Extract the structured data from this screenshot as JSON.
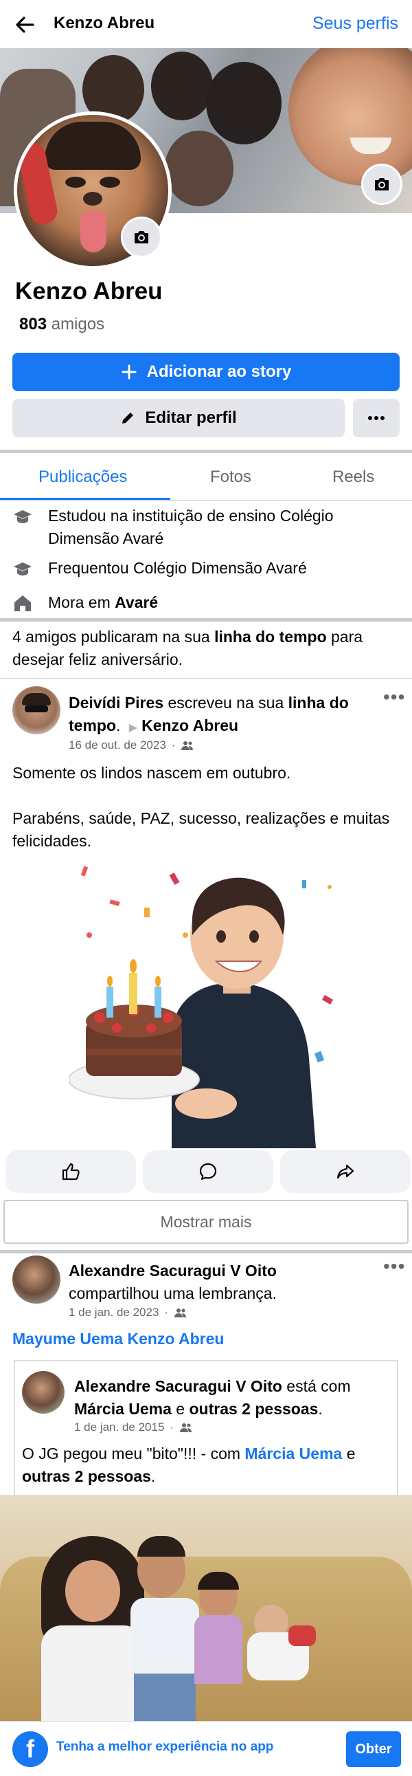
{
  "header": {
    "title": "Kenzo Abreu",
    "link": "Seus perfis"
  },
  "profile": {
    "name": "Kenzo Abreu",
    "friends_count": "803",
    "friends_label": "amigos"
  },
  "buttons": {
    "add_story": "Adicionar ao story",
    "edit_profile": "Editar perfil"
  },
  "tabs": [
    {
      "label": "Publicações",
      "active": true
    },
    {
      "label": "Fotos",
      "active": false
    },
    {
      "label": "Reels",
      "active": false
    }
  ],
  "info": [
    {
      "icon": "graduation-cap-icon",
      "text": "Estudou na instituição de ensino Colégio Dimensão Avaré"
    },
    {
      "icon": "graduation-cap-icon",
      "text": "Frequentou Colégio Dimensão Avaré"
    },
    {
      "icon": "home-icon",
      "prefix": "Mora em ",
      "bold": "Avaré"
    }
  ],
  "birthday_note": {
    "prefix": "4 amigos publicaram na sua ",
    "bold": "linha do tempo",
    "suffix": " para desejar feliz aniversário."
  },
  "post1": {
    "author": "Deivídi Pires",
    "action": " escreveu na sua ",
    "target": "linha do tempo",
    "period": ".",
    "recipient": "Kenzo Abreu",
    "date": "16 de out. de 2023",
    "text_line1": "Somente os lindos nascem em outubro.",
    "text_line2": "Parabéns, saúde, PAZ, sucesso, realizações e muitas felicidades."
  },
  "show_more": "Mostrar mais",
  "post2": {
    "author": "Alexandre Sacuragui V Oito",
    "action": "compartilhou uma lembrança.",
    "date": "1 de jan. de 2023",
    "tagline": "Mayume Uema Kenzo Abreu",
    "shared": {
      "author": "Alexandre Sacuragui V Oito",
      "with": " está com ",
      "tag1": "Márcia Uema",
      "and": " e ",
      "tag2": "outras 2 pessoas",
      "period": ".",
      "date": "1 de jan. de 2015",
      "text_prefix": "O JG pegou meu \"bito\"!!! - com ",
      "text_tag1": "Márcia Uema",
      "text_and": " e ",
      "text_tag2": "outras 2 pessoas",
      "text_period": "."
    }
  },
  "bottom_bar": {
    "text": "Tenha a melhor experiência no app",
    "button": "Obter"
  },
  "colors": {
    "accent": "#1877f2",
    "secondary_text": "#65676b",
    "button_gray": "#e4e6eb"
  }
}
